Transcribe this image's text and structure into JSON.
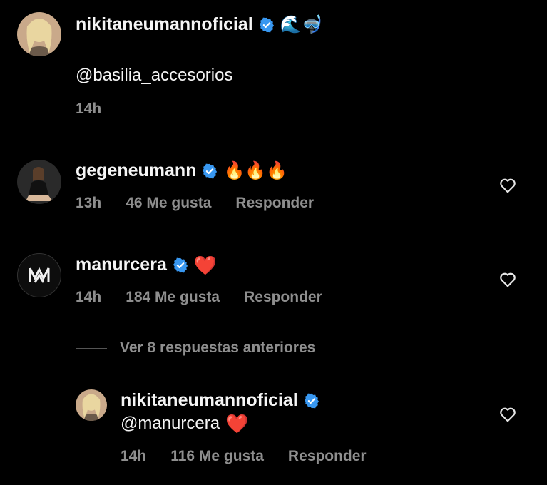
{
  "caption": {
    "username": "nikitaneumannoficial",
    "text": "@basilia_accesorios",
    "time": "14h",
    "emoji": "🌊🤿"
  },
  "comments": [
    {
      "username": "gegeneumann",
      "emoji": "🔥🔥🔥",
      "time": "13h",
      "likes": "46 Me gusta",
      "reply": "Responder"
    },
    {
      "username": "manurcera",
      "emoji": "❤️",
      "time": "14h",
      "likes": "184 Me gusta",
      "reply": "Responder"
    }
  ],
  "view_replies": "Ver 8 respuestas anteriores",
  "reply": {
    "username": "nikitaneumannoficial",
    "text": "@manurcera",
    "emoji": "❤️",
    "time": "14h",
    "likes": "116 Me gusta",
    "reply": "Responder"
  },
  "colors": {
    "background": "#000000",
    "verified": "#3897f0",
    "secondary_text": "#8e8e8e",
    "heart_red": "#ed2b3d"
  }
}
